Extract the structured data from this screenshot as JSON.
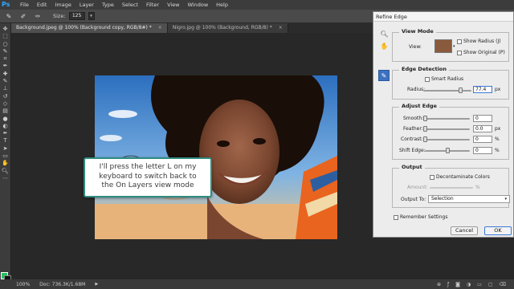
{
  "app": {
    "logo": "Ps",
    "menu": [
      "File",
      "Edit",
      "Image",
      "Layer",
      "Type",
      "Select",
      "Filter",
      "View",
      "Window",
      "Help"
    ]
  },
  "options_bar": {
    "size_label": "Size:",
    "size_value": "125"
  },
  "tabs": [
    {
      "label": "Background.jpeg @ 100% (Background copy, RGB/8#) *",
      "close": "×"
    },
    {
      "label": "Nigro.jpg @ 100% (Background, RGB/8) *",
      "close": "×"
    }
  ],
  "callout": {
    "line1": "I'll press the letter L on my",
    "line2": "keyboard to switch back to",
    "line3": "the On Layers view mode"
  },
  "status": {
    "zoom": "100%",
    "doc": "Doc: 736.3K/1.68M",
    "arrow": "▶"
  },
  "dialog": {
    "title": "Refine Edge",
    "view_mode": {
      "title": "View Mode",
      "view_label": "View:",
      "show_radius": "Show Radius (J)",
      "show_original": "Show Original (P)"
    },
    "edge_detection": {
      "title": "Edge Detection",
      "smart_radius": "Smart Radius",
      "radius_label": "Radius:",
      "radius_value": "77.4",
      "radius_fraction": 0.77,
      "unit": "px"
    },
    "adjust_edge": {
      "title": "Adjust Edge",
      "smooth_label": "Smooth:",
      "smooth_value": "0",
      "feather_label": "Feather:",
      "feather_value": "0.0",
      "feather_unit": "px",
      "contrast_label": "Contrast:",
      "contrast_value": "0",
      "contrast_unit": "%",
      "shift_label": "Shift Edge:",
      "shift_value": "0",
      "shift_unit": "%"
    },
    "output": {
      "title": "Output",
      "decontaminate": "Decontaminate Colors",
      "amount_label": "Amount:",
      "amount_unit": "%",
      "output_to_label": "Output To:",
      "output_to_value": "Selection"
    },
    "remember": "Remember Settings",
    "cancel": "Cancel",
    "ok": "OK"
  }
}
